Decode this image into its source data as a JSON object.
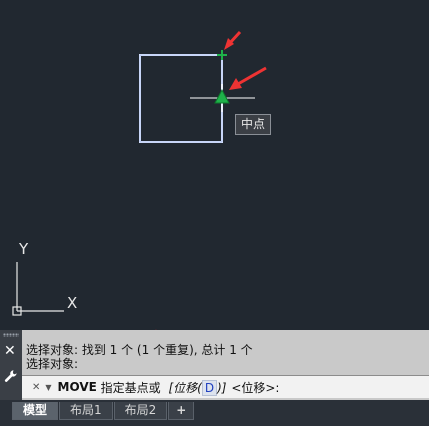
{
  "drawing": {
    "tooltip": "中点",
    "ucs": {
      "x_label": "X",
      "y_label": "Y"
    }
  },
  "command_line": {
    "history": [
      "选择对象: 找到 1 个 (1 个重复), 总计 1 个",
      "选择对象:"
    ],
    "command": "MOVE",
    "prompt": " 指定基点或 ",
    "option_open": "[位移(",
    "option_key": "D",
    "option_close": ")]",
    "default": " <位移>:"
  },
  "tabs": [
    "模型",
    "布局1",
    "布局2"
  ],
  "add_tab": "+",
  "colors": {
    "background": "#212830",
    "square": "#dbe6ff",
    "snap_marker": "#1fb24a",
    "arrow": "#ee3333"
  }
}
